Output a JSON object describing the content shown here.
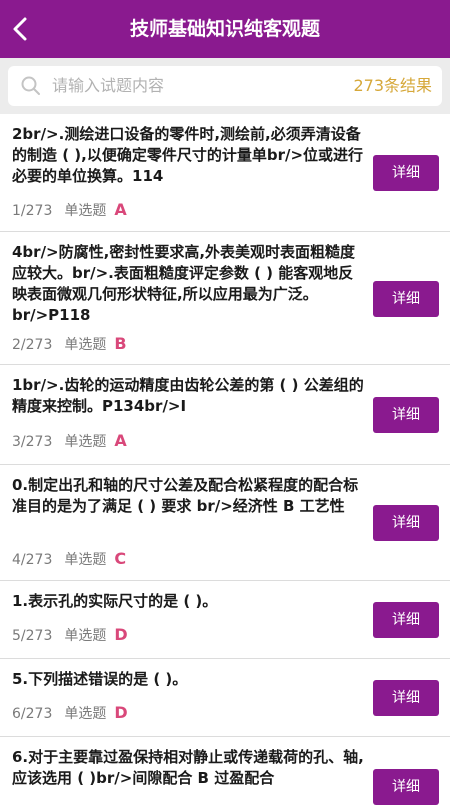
{
  "header": {
    "title": "技师基础知识纯客观题"
  },
  "search": {
    "placeholder": "请输入试题内容",
    "count": "273条结果"
  },
  "detail_label": "详细",
  "questions": [
    {
      "text": "2br/>.测绘进口设备的零件时,测绘前,必须弄清设备的制造 ( ),以便确定零件尺寸的计量单br/>位或进行必要的单位换算。114",
      "index": "1/273",
      "type": "单选题",
      "answer": "A"
    },
    {
      "text": "4br/>防腐性,密封性要求高,外表美观时表面粗糙度应较大。br/>.表面粗糙度评定参数 ( ) 能客观地反映表面微观几何形状特征,所以应用最为广泛。br/>P118",
      "index": "2/273",
      "type": "单选题",
      "answer": "B"
    },
    {
      "text": "1br/>.齿轮的运动精度由齿轮公差的第 ( ) 公差组的精度来控制。P134br/>I",
      "index": "3/273",
      "type": "单选题",
      "answer": "A"
    },
    {
      "text": "0.制定出孔和轴的尺寸公差及配合松紧程度的配合标准目的是为了满足 ( ) 要求 br/>经济性 B 工艺性",
      "index": "4/273",
      "type": "单选题",
      "answer": "C"
    },
    {
      "text": "1.表示孔的实际尺寸的是 ( )。",
      "index": "5/273",
      "type": "单选题",
      "answer": "D"
    },
    {
      "text": "5.下列描述错误的是 ( )。",
      "index": "6/273",
      "type": "单选题",
      "answer": "D"
    },
    {
      "text": "6.对于主要靠过盈保持相对静止或传递载荷的孔、轴,应该选用 ( )br/>间隙配合 B 过盈配合",
      "index": "",
      "type": "",
      "answer": ""
    }
  ]
}
